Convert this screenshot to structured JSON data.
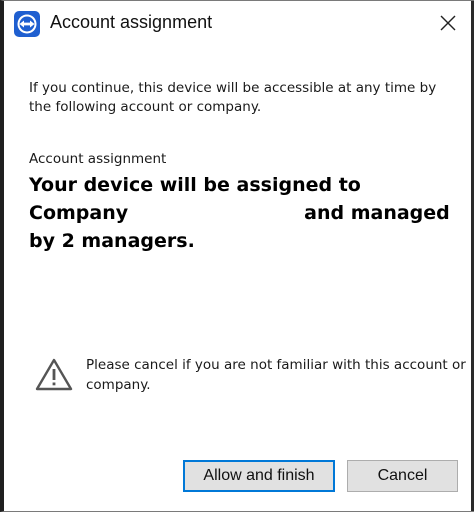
{
  "window": {
    "title": "Account assignment",
    "app_icon": "teamviewer-logo-icon",
    "close_icon": "close-icon"
  },
  "content": {
    "intro": "If you continue, this device will be accessible at any time by the following account or company.",
    "section_label": "Account assignment",
    "assignment": {
      "line1": "Your device will be assigned to",
      "line2_prefix": "Company",
      "line2_suffix": "and managed",
      "line3": "by 2 managers."
    },
    "warning": {
      "icon": "warning-triangle-icon",
      "text": "Please cancel if you are not familiar with this account or company."
    }
  },
  "buttons": {
    "allow_label": "Allow and finish",
    "cancel_label": "Cancel"
  },
  "colors": {
    "accent": "#0078d7",
    "app_icon_bg": "#1f5fd0",
    "button_bg": "#e1e1e1"
  }
}
